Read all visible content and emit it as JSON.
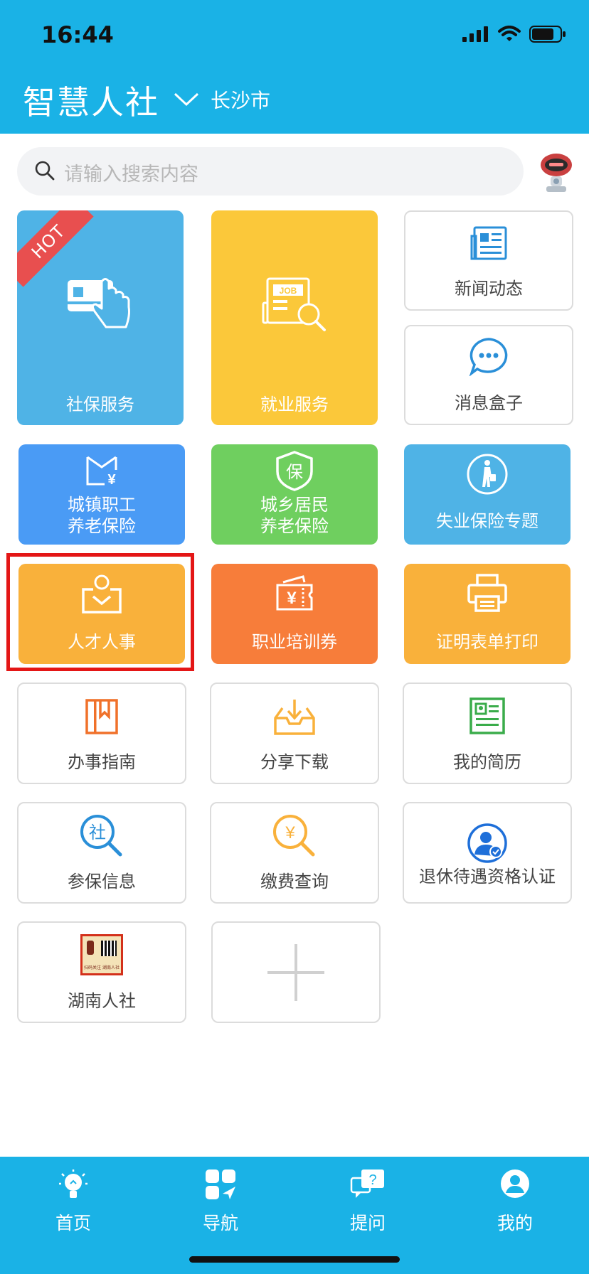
{
  "status_bar": {
    "time": "16:44"
  },
  "header": {
    "title": "智慧人社",
    "city": "长沙市"
  },
  "search": {
    "placeholder": "请输入搜索内容"
  },
  "tiles": {
    "social_security": {
      "label": "社保服务",
      "badge": "HOT"
    },
    "employment": {
      "label": "就业服务"
    },
    "news": {
      "label": "新闻动态"
    },
    "message_box": {
      "label": "消息盒子"
    },
    "urban_pension": {
      "line1": "城镇职工",
      "line2": "养老保险"
    },
    "rural_pension": {
      "line1": "城乡居民",
      "line2": "养老保险"
    },
    "unemployment": {
      "label": "失业保险专题"
    },
    "talent_hr": {
      "label": "人才人事"
    },
    "training_voucher": {
      "label": "职业培训券"
    },
    "certificate_print": {
      "label": "证明表单打印"
    },
    "service_guide": {
      "label": "办事指南"
    },
    "share_download": {
      "label": "分享下载"
    },
    "my_resume": {
      "label": "我的简历"
    },
    "insurance_info": {
      "label": "参保信息"
    },
    "payment_query": {
      "label": "缴费查询"
    },
    "retirement_cert": {
      "label": "退休待遇资格认证"
    },
    "hunan_hr": {
      "label": "湖南人社",
      "thumb_text1": "扫码关注",
      "thumb_text2": "湖南人社"
    }
  },
  "colors": {
    "brand": "#1ab2e6",
    "hot": "#e84f4f",
    "highlight": "#e41616"
  },
  "tabbar": {
    "home": "首页",
    "nav": "导航",
    "ask": "提问",
    "mine": "我的"
  }
}
